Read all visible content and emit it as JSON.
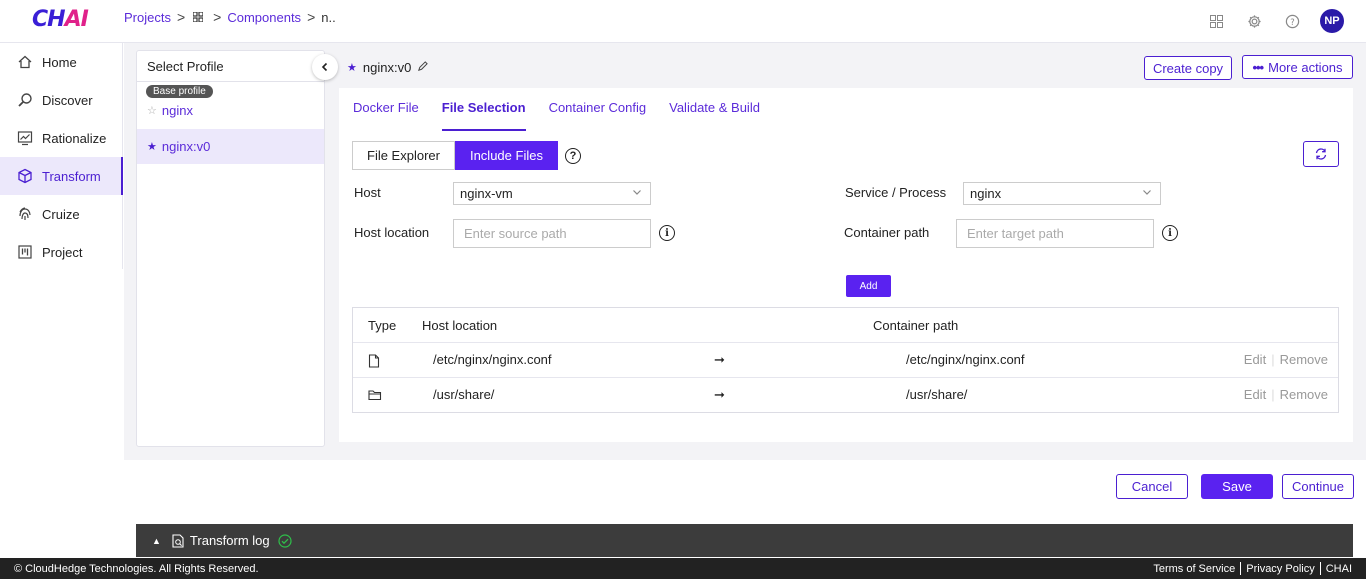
{
  "app": {
    "logo_main": "CH",
    "logo_accent": "AI"
  },
  "breadcrumb": {
    "projects": "Projects",
    "components": "Components",
    "current": "n.."
  },
  "header_icons": [
    "apps-grid-icon",
    "gear-icon",
    "help-icon"
  ],
  "user": {
    "initials": "NP"
  },
  "nav": {
    "items": [
      {
        "label": "Home",
        "icon": "home-icon"
      },
      {
        "label": "Discover",
        "icon": "search-icon"
      },
      {
        "label": "Rationalize",
        "icon": "chart-icon"
      },
      {
        "label": "Transform",
        "icon": "cube-icon",
        "active": true
      },
      {
        "label": "Cruize",
        "icon": "fingerprint-icon"
      },
      {
        "label": "Project",
        "icon": "board-icon"
      }
    ]
  },
  "profile": {
    "title": "Select Profile",
    "base_badge": "Base profile",
    "base_name": "nginx",
    "selected_name": "nginx:v0"
  },
  "component": {
    "title": "nginx:v0"
  },
  "actions": {
    "create_copy": "Create copy",
    "more_actions": "More actions"
  },
  "tabs": [
    {
      "label": "Docker File"
    },
    {
      "label": "File Selection",
      "active": true
    },
    {
      "label": "Container Config"
    },
    {
      "label": "Validate & Build"
    }
  ],
  "segment": {
    "file_explorer": "File Explorer",
    "include_files": "Include Files"
  },
  "form": {
    "host_label": "Host",
    "host_value": "nginx-vm",
    "service_label": "Service / Process",
    "service_value": "nginx",
    "host_location_label": "Host location",
    "host_location_placeholder": "Enter source path",
    "container_path_label": "Container path",
    "container_path_placeholder": "Enter target path",
    "add_label": "Add"
  },
  "table": {
    "headers": {
      "type": "Type",
      "host_location": "Host location",
      "container_path": "Container path"
    },
    "rows": [
      {
        "type_icon": "file-icon",
        "host": "/etc/nginx/nginx.conf",
        "container": "/etc/nginx/nginx.conf",
        "edit": "Edit",
        "remove": "Remove"
      },
      {
        "type_icon": "folder-icon",
        "host": "/usr/share/",
        "container": "/usr/share/",
        "edit": "Edit",
        "remove": "Remove"
      }
    ]
  },
  "footer_buttons": {
    "cancel": "Cancel",
    "save": "Save",
    "continue": "Continue"
  },
  "log": {
    "label": "Transform log"
  },
  "footer": {
    "copyright": "© CloudHedge Technologies. All Rights Reserved.",
    "terms": "Terms of Service",
    "privacy": "Privacy Policy",
    "brand": "CHAI"
  },
  "colors": {
    "accent": "#5a22f0",
    "brand": "#3a1fd6",
    "brand_pink": "#e0218a"
  }
}
